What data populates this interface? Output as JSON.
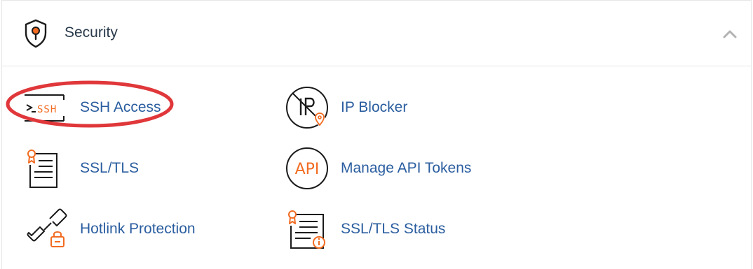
{
  "section": {
    "title": "Security",
    "icon": "shield-icon",
    "collapse_icon": "chevron-up-icon",
    "expanded": true
  },
  "items": [
    {
      "id": "ssh-access",
      "label": "SSH Access",
      "icon": "ssh-terminal-icon",
      "highlighted": true
    },
    {
      "id": "ip-blocker",
      "label": "IP Blocker",
      "icon": "ip-blocker-icon"
    },
    {
      "id": "ssl-tls",
      "label": "SSL/TLS",
      "icon": "certificate-icon"
    },
    {
      "id": "manage-api-tokens",
      "label": "Manage API Tokens",
      "icon": "api-icon"
    },
    {
      "id": "hotlink-protection",
      "label": "Hotlink Protection",
      "icon": "broken-link-lock-icon"
    },
    {
      "id": "ssl-tls-status",
      "label": "SSL/TLS Status",
      "icon": "certificate-info-icon"
    }
  ],
  "colors": {
    "accent": "#f26b21",
    "link": "#2a5d9f",
    "title": "#293a4a",
    "highlight_ring": "#e0373a",
    "divider": "#e6e6e6",
    "chevron": "#b3b3b3"
  }
}
